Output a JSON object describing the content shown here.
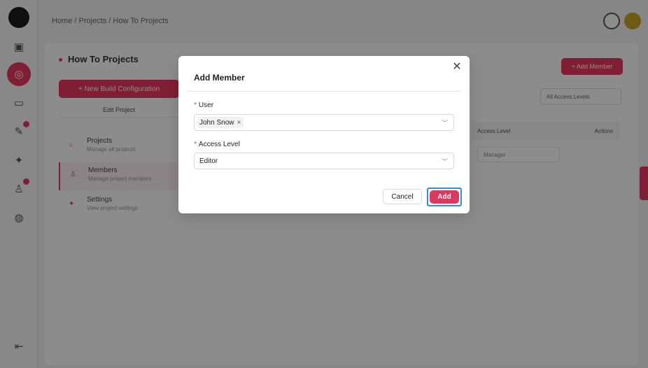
{
  "app": {
    "breadcrumb": "Home / Projects / How To Projects",
    "page_title": "How To Projects",
    "add_member_button": "+ Add Member",
    "new_build_button": "+ New Build Configuration",
    "edit_project": "Edit Project",
    "menu": [
      {
        "title": "Projects",
        "subtitle": "Manage all projects"
      },
      {
        "title": "Members",
        "subtitle": "Manage project members"
      },
      {
        "title": "Settings",
        "subtitle": "View project settings"
      }
    ],
    "access_filter": "All Access Levels",
    "table_headers": {
      "access": "Access Level",
      "actions": "Actions"
    },
    "row_access": "Manager"
  },
  "modal": {
    "title": "Add Member",
    "close_icon": "close-icon",
    "user": {
      "label": "User",
      "selected_tag": "John Snow",
      "remove_icon": "×"
    },
    "access_level": {
      "label": "Access Level",
      "value": "Editor"
    },
    "required_mark": "*",
    "cancel_label": "Cancel",
    "add_label": "Add"
  },
  "colors": {
    "accent": "#e8385f",
    "focus_ring": "#2f8ee6"
  }
}
